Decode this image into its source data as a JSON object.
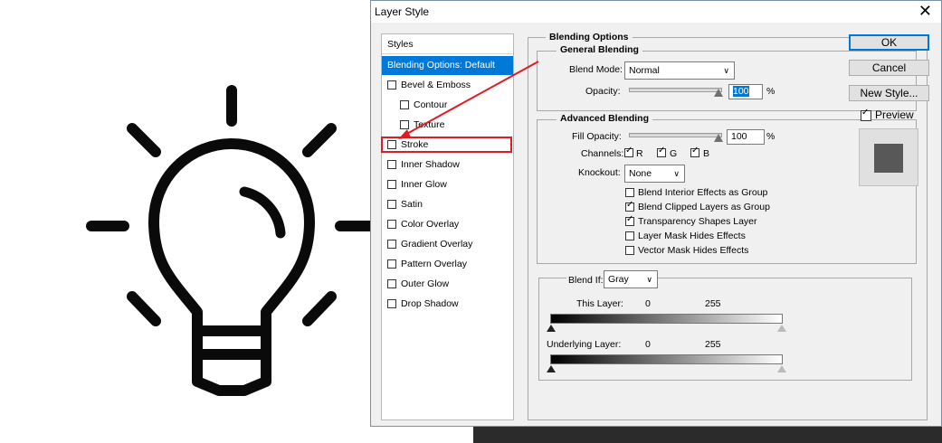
{
  "dialog": {
    "title": "Layer Style",
    "close_glyph": "✕"
  },
  "styles_panel": {
    "header": "Styles",
    "selected_item": "Blending Options: Default",
    "items": [
      {
        "label": "Bevel & Emboss",
        "checked": false
      },
      {
        "label": "Contour",
        "checked": false
      },
      {
        "label": "Texture",
        "checked": false
      },
      {
        "label": "Stroke",
        "checked": false
      },
      {
        "label": "Inner Shadow",
        "checked": false
      },
      {
        "label": "Inner Glow",
        "checked": false
      },
      {
        "label": "Satin",
        "checked": false
      },
      {
        "label": "Color Overlay",
        "checked": false
      },
      {
        "label": "Gradient Overlay",
        "checked": false
      },
      {
        "label": "Pattern Overlay",
        "checked": false
      },
      {
        "label": "Outer Glow",
        "checked": false
      },
      {
        "label": "Drop Shadow",
        "checked": false
      }
    ]
  },
  "blending_options": {
    "title": "Blending Options",
    "general": {
      "title": "General Blending",
      "blend_mode_label": "Blend Mode:",
      "blend_mode_value": "Normal",
      "opacity_label": "Opacity:",
      "opacity_value": "100",
      "opacity_unit": "%",
      "opacity_level": 1.0
    },
    "advanced": {
      "title": "Advanced Blending",
      "fill_opacity_label": "Fill Opacity:",
      "fill_opacity_value": "100",
      "fill_opacity_unit": "%",
      "fill_opacity_level": 1.0,
      "channels_label": "Channels:",
      "channels": {
        "r": "R",
        "g": "G",
        "b": "B"
      },
      "knockout_label": "Knockout:",
      "knockout_value": "None",
      "options": [
        {
          "label": "Blend Interior Effects as Group",
          "checked": false
        },
        {
          "label": "Blend Clipped Layers as Group",
          "checked": true
        },
        {
          "label": "Transparency Shapes Layer",
          "checked": true
        },
        {
          "label": "Layer Mask Hides Effects",
          "checked": false
        },
        {
          "label": "Vector Mask Hides Effects",
          "checked": false
        }
      ]
    },
    "blend_if": {
      "label": "Blend If:",
      "value": "Gray",
      "this_layer_label": "This Layer:",
      "this_layer_min": "0",
      "this_layer_max": "255",
      "underlying_label": "Underlying Layer:",
      "underlying_min": "0",
      "underlying_max": "255"
    }
  },
  "buttons": {
    "ok": "OK",
    "cancel": "Cancel",
    "new_style": "New Style...",
    "preview_label": "Preview",
    "preview_checked": true
  },
  "colors": {
    "selection": "#0078d7",
    "highlight_box": "#e21b23",
    "preview_square": "#585858"
  }
}
